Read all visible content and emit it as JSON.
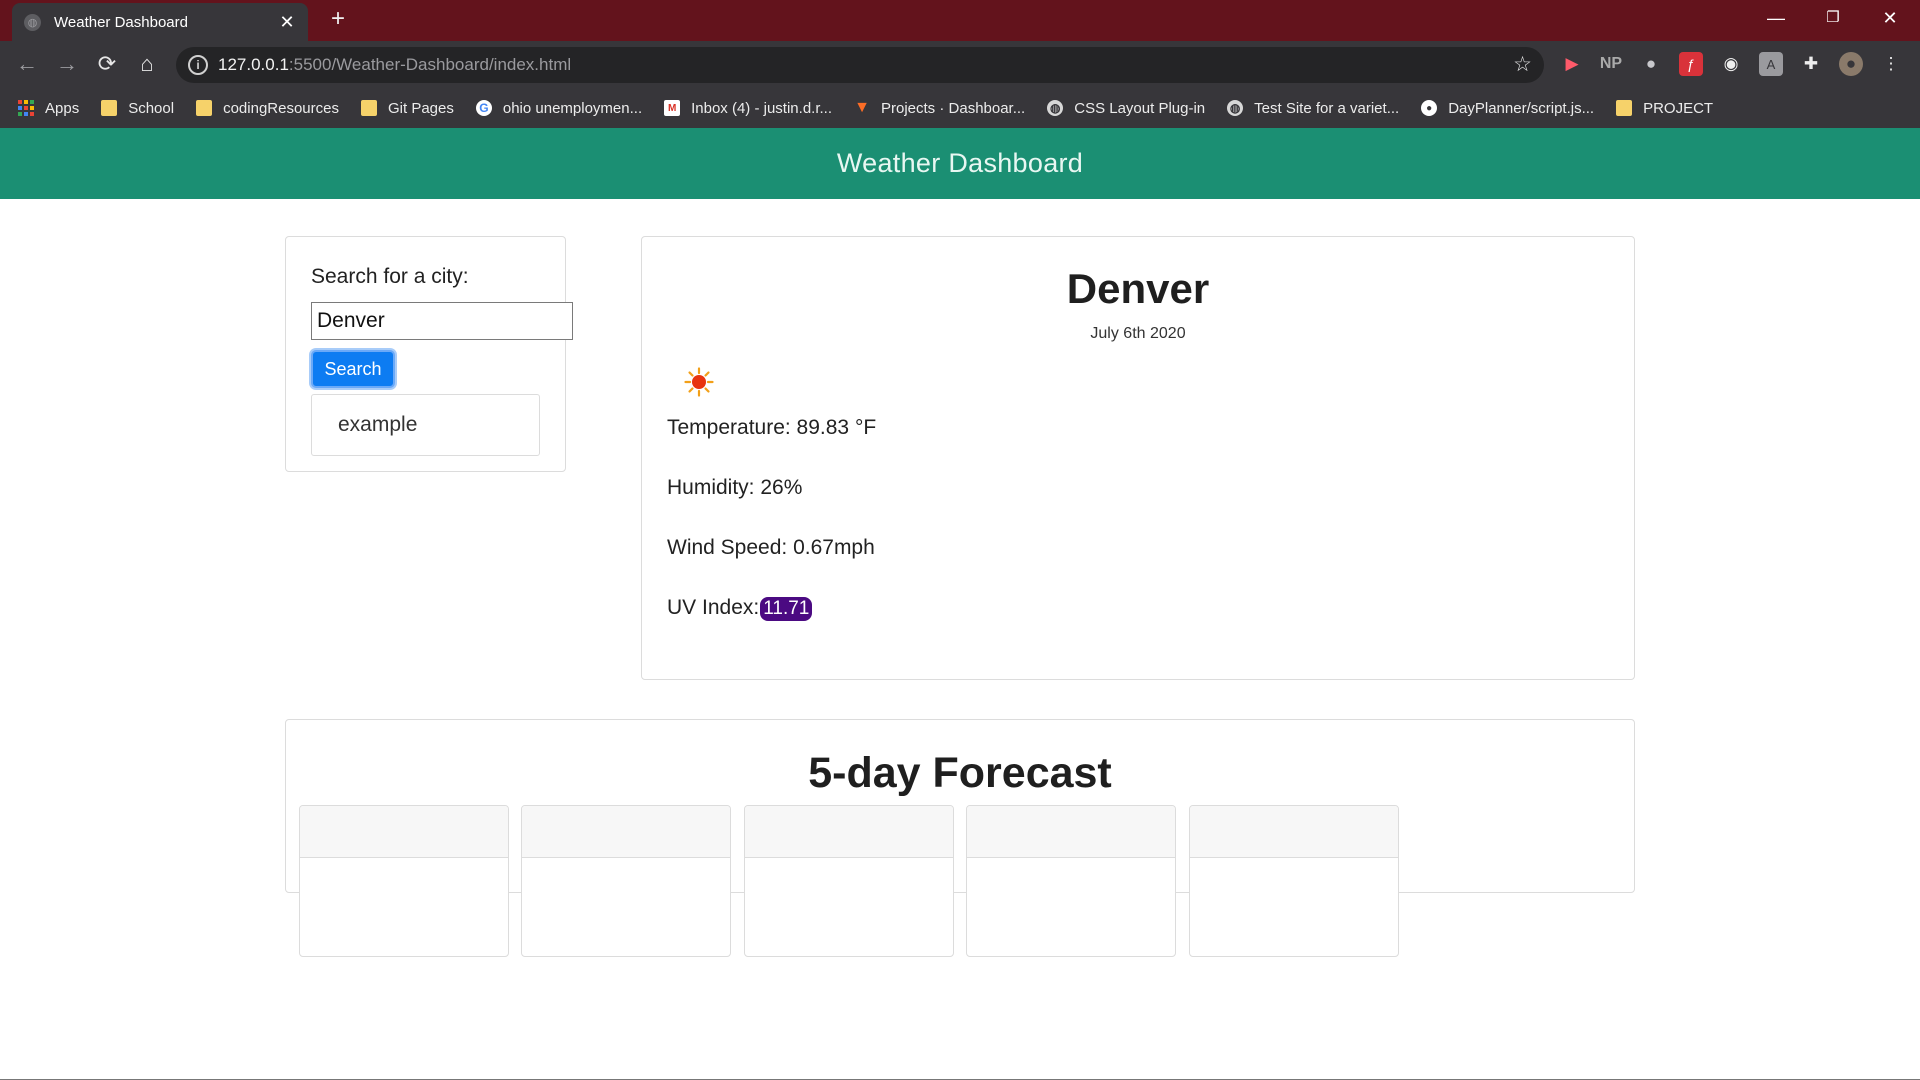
{
  "browser": {
    "tab_title": "Weather Dashboard",
    "url_host": "127.0.0.1",
    "url_rest": ":5500/Weather-Dashboard/index.html",
    "bookmarks": [
      {
        "label": "Apps",
        "icon": "apps-grid-icon"
      },
      {
        "label": "School",
        "icon": "folder-icon"
      },
      {
        "label": "codingResources",
        "icon": "folder-icon"
      },
      {
        "label": "Git Pages",
        "icon": "folder-icon"
      },
      {
        "label": "ohio unemploymen...",
        "icon": "google-icon"
      },
      {
        "label": "Inbox (4) - justin.d.r...",
        "icon": "gmail-icon"
      },
      {
        "label": "Projects · Dashboar...",
        "icon": "gitlab-icon"
      },
      {
        "label": "CSS Layout Plug-in",
        "icon": "globe-icon"
      },
      {
        "label": "Test Site for a variet...",
        "icon": "globe-icon"
      },
      {
        "label": "DayPlanner/script.js...",
        "icon": "github-icon"
      },
      {
        "label": "PROJECT",
        "icon": "folder-icon"
      }
    ],
    "extensions": {
      "np_label": "NP"
    }
  },
  "header": {
    "title": "Weather Dashboard"
  },
  "search": {
    "label": "Search for a city:",
    "input_value": "Denver",
    "button_label": "Search",
    "history": [
      "example"
    ]
  },
  "current": {
    "city": "Denver",
    "date": "July 6th 2020",
    "icon": "sun-icon",
    "temperature": "Temperature: 89.83 °F",
    "humidity": "Humidity: 26%",
    "wind": "Wind Speed: 0.67mph",
    "uv_label": "UV Index:",
    "uv_value": "11.71",
    "uv_color": "#4b0a82"
  },
  "forecast": {
    "title": "5-day Forecast"
  },
  "colors": {
    "header_bg": "#1b8f73",
    "title_bar": "#63131c",
    "button_blue": "#0d7cf2"
  }
}
